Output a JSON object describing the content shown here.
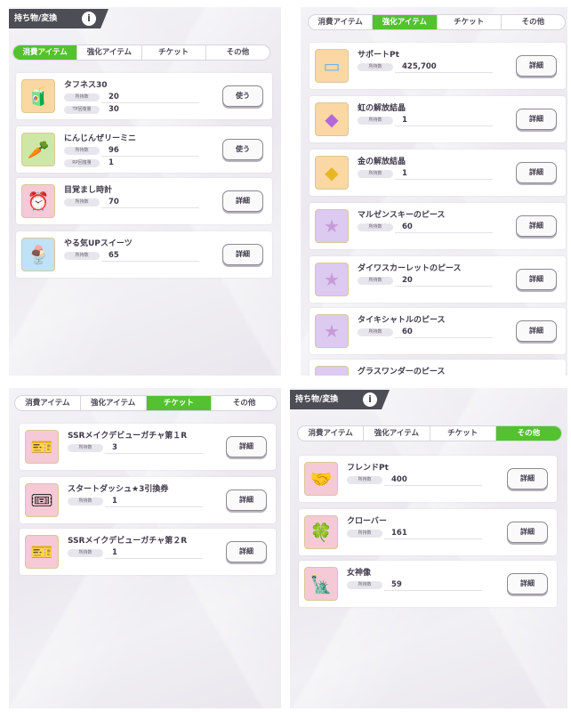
{
  "tabs": {
    "consumable": "消費アイテム",
    "enhance": "強化アイテム",
    "ticket": "チケット",
    "other": "その他"
  },
  "header": {
    "title": "持ち物/変換",
    "info_glyph": "i"
  },
  "stat_labels": {
    "owned": "所持数",
    "tp_recover": "TP回復量",
    "rp_recover": "RP回復量"
  },
  "buttons": {
    "use": "使う",
    "detail": "詳細"
  },
  "consumable_items": [
    {
      "name": "タフネス30",
      "icon": "drink-icon",
      "owned": "20",
      "recover": "30",
      "recover_label_key": "tp_recover",
      "button": "使う"
    },
    {
      "name": "にんじんぜリーミニ",
      "icon": "carrot-jelly-icon",
      "owned": "96",
      "recover": "1",
      "recover_label_key": "rp_recover",
      "button": "使う"
    },
    {
      "name": "目覚まし時計",
      "icon": "alarm-clock-icon",
      "owned": "70",
      "button": "詳細"
    },
    {
      "name": "やる気UPスイーツ",
      "icon": "parfait-icon",
      "owned": "65",
      "button": "詳細"
    }
  ],
  "enhance_items": [
    {
      "name": "サポートPt",
      "icon": "support-card-icon",
      "owned": "425,700"
    },
    {
      "name": "虹の解放結晶",
      "icon": "rainbow-crystal-icon",
      "owned": "1"
    },
    {
      "name": "金の解放結晶",
      "icon": "gold-crystal-icon",
      "owned": "1"
    },
    {
      "name": "マルゼンスキーのピース",
      "icon": "character-piece-icon",
      "owned": "60"
    },
    {
      "name": "ダイワスカーレットのピース",
      "icon": "character-piece-icon",
      "owned": "20"
    },
    {
      "name": "タイキシャトルのピース",
      "icon": "character-piece-icon",
      "owned": "60"
    },
    {
      "name": "グラスワンダーのピース",
      "icon": "character-piece-icon",
      "owned": ""
    }
  ],
  "ticket_items": [
    {
      "name": "SSRメイクデビューガチャ第１R",
      "icon": "ssr-ticket-icon",
      "owned": "3"
    },
    {
      "name": "スタートダッシュ★3引換券",
      "icon": "star-ticket-icon",
      "owned": "1"
    },
    {
      "name": "SSRメイクデビューガチャ第２R",
      "icon": "ssr-ticket-icon",
      "owned": "1"
    }
  ],
  "other_items": [
    {
      "name": "フレンドPt",
      "icon": "handshake-icon",
      "owned": "400"
    },
    {
      "name": "クローバー",
      "icon": "clover-icon",
      "owned": "161"
    },
    {
      "name": "女神像",
      "icon": "goddess-statue-icon",
      "owned": "59"
    }
  ],
  "icon_glyphs": {
    "drink-icon": "🧃",
    "carrot-jelly-icon": "🥕",
    "alarm-clock-icon": "⏰",
    "parfait-icon": "🍨",
    "support-card-icon": "▭",
    "rainbow-crystal-icon": "◆",
    "gold-crystal-icon": "◆",
    "character-piece-icon": "★",
    "ssr-ticket-icon": "🎫",
    "star-ticket-icon": "🎟",
    "handshake-icon": "🤝",
    "clover-icon": "🍀",
    "goddess-statue-icon": "🗽"
  },
  "colors": {
    "active_tab": "#54c130",
    "header_bg": "#4d4d55"
  }
}
